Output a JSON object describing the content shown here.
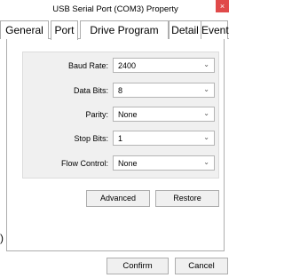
{
  "window": {
    "title": "USB Serial Port (COM3) Property",
    "close_glyph": "×"
  },
  "tabs": [
    {
      "label": "General",
      "active": false
    },
    {
      "label": "Port",
      "active": true
    },
    {
      "label": "Drive Program",
      "active": false
    },
    {
      "label": "Detail",
      "active": false
    },
    {
      "label": "Event",
      "active": false
    }
  ],
  "settings": {
    "baud_rate": {
      "label": "Baud Rate:",
      "value": "2400"
    },
    "data_bits": {
      "label": "Data Bits:",
      "value": "8"
    },
    "parity": {
      "label": "Parity:",
      "value": "None"
    },
    "stop_bits": {
      "label": "Stop Bits:",
      "value": "1"
    },
    "flow_control": {
      "label": "Flow Control:",
      "value": "None"
    },
    "chevron_glyph": "⌄"
  },
  "actions": {
    "advanced_label": "Advanced",
    "restore_label": "Restore"
  },
  "footer": {
    "confirm_label": "Confirm",
    "cancel_label": "Cancel"
  },
  "edge_glyph": ")"
}
